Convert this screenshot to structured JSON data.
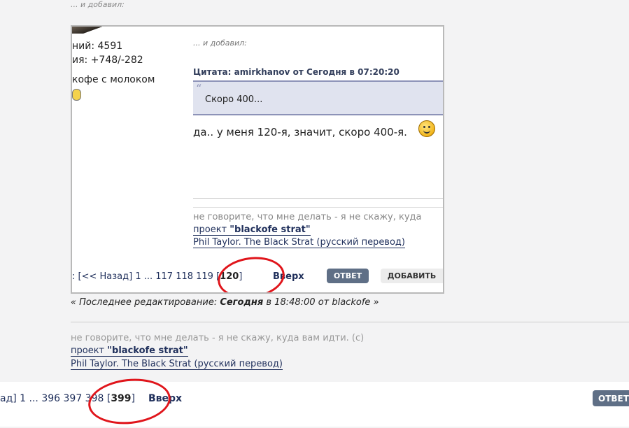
{
  "top_note": "... и добавил:",
  "embedded": {
    "stats": [
      "ний: 4591",
      "ия: +748/-282",
      "кофе с молоком"
    ],
    "added_note": "... и добавил:",
    "quote_header": "Цитата: amirkhanov от Сегодня в 07:20:20",
    "quote_text": "Скоро 400...",
    "reply_text": "да.. у меня 120-я, значит, скоро 400-я.",
    "signature_line": "не говорите, что мне делать - я не скажу, куда",
    "signature_link1_prefix": "проект ",
    "signature_link1_bold": "\"blackofe strat\"",
    "signature_link2": "Phil Taylor. The Black Strat (русский перевод)",
    "pager_text": ": [<< Назад] 1 ... 117 118 119 [",
    "pager_current": "120",
    "pager_close": "]",
    "up_label": "Вверх",
    "reply_button": "ОТВЕТ",
    "add_button": "ДОБАВИТЬ"
  },
  "edit_note": {
    "prefix": "« Последнее редактирование: ",
    "day": "Сегодня",
    "suffix": " в 18:48:00 от blackofe »"
  },
  "signature": {
    "line": "не говорите, что мне делать - я не скажу, куда вам идти. (с)",
    "link1_prefix": "проект ",
    "link1_bold": "\"blackofe strat\"",
    "link2": "Phil Taylor. The Black Strat (русский перевод)"
  },
  "pager": {
    "text": "ад] 1 ... 396 397 398 [",
    "current": "399",
    "close": "]",
    "up_label": "Вверх"
  },
  "reply_button": "ОТВЕТ"
}
